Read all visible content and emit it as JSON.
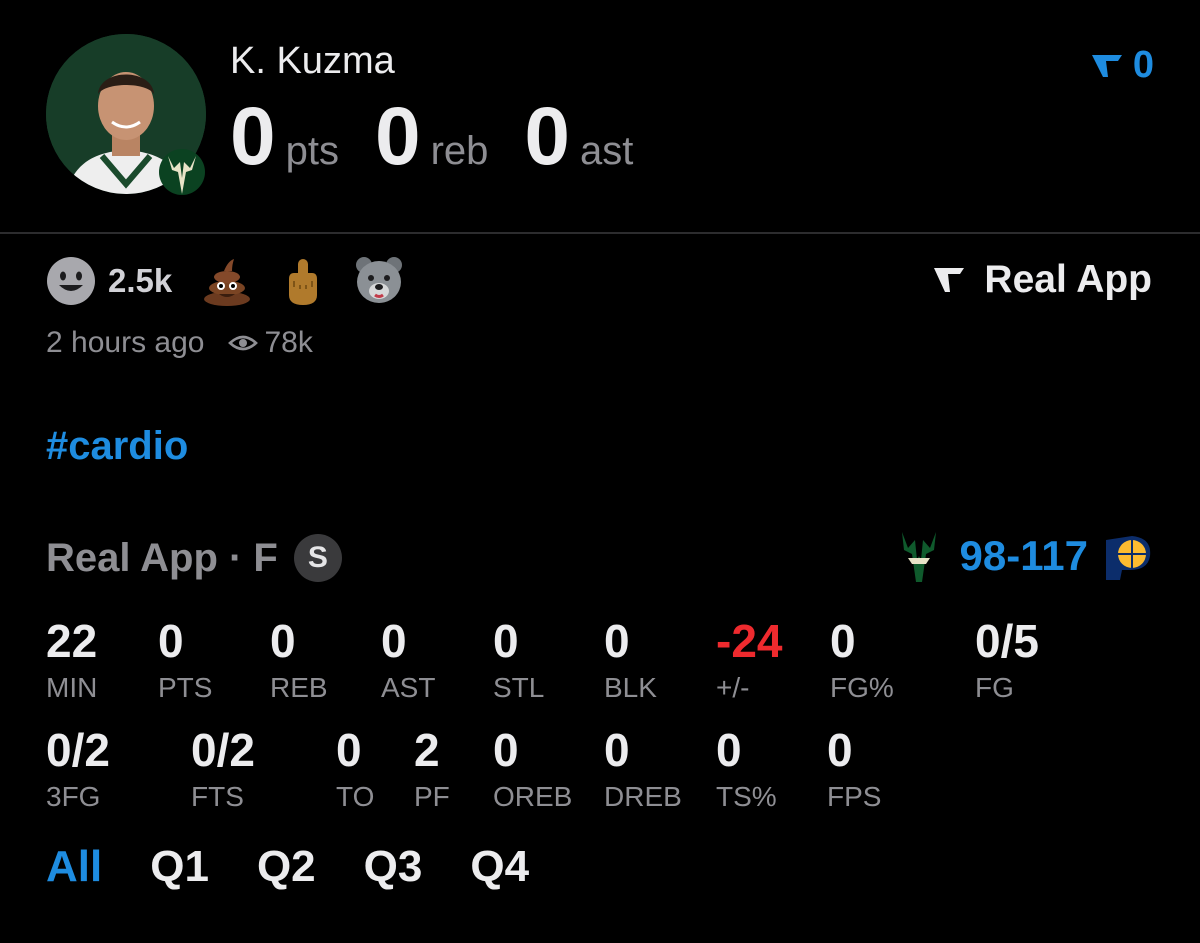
{
  "player": {
    "name": "K. Kuzma",
    "headline": [
      {
        "value": "0",
        "unit": "pts"
      },
      {
        "value": "0",
        "unit": "reb"
      },
      {
        "value": "0",
        "unit": "ast"
      }
    ]
  },
  "vote_counter": {
    "value": "0",
    "icon": "real-app-logo-icon"
  },
  "reactions": {
    "count": "2.5k",
    "icons": [
      "smiley-icon",
      "poop-emoji-icon",
      "middle-finger-emoji-icon",
      "bear-emoji-icon"
    ]
  },
  "brand_link": {
    "label": "Real App",
    "icon": "real-app-logo-icon"
  },
  "post_meta": {
    "time": "2 hours ago",
    "views": "78k",
    "views_icon": "eye-icon"
  },
  "hashtag": "#cardio",
  "game": {
    "label": "Real App · F",
    "status_chip": "S",
    "score": "98-117",
    "home_team_icon": "bucks-logo-icon",
    "away_team_icon": "pacers-logo-icon"
  },
  "stats_row1": [
    {
      "value": "22",
      "label": "MIN"
    },
    {
      "value": "0",
      "label": "PTS"
    },
    {
      "value": "0",
      "label": "REB"
    },
    {
      "value": "0",
      "label": "AST"
    },
    {
      "value": "0",
      "label": "STL"
    },
    {
      "value": "0",
      "label": "BLK"
    },
    {
      "value": "-24",
      "label": "+/-"
    },
    {
      "value": "0",
      "label": "FG%"
    },
    {
      "value": "0/5",
      "label": "FG"
    }
  ],
  "stats_row2": [
    {
      "value": "0/2",
      "label": "3FG"
    },
    {
      "value": "0/2",
      "label": "FTS"
    },
    {
      "value": "0",
      "label": "TO"
    },
    {
      "value": "2",
      "label": "PF"
    },
    {
      "value": "0",
      "label": "OREB"
    },
    {
      "value": "0",
      "label": "DREB"
    },
    {
      "value": "0",
      "label": "TS%"
    },
    {
      "value": "0",
      "label": "FPS"
    }
  ],
  "tabs": [
    {
      "label": "All",
      "active": true
    },
    {
      "label": "Q1",
      "active": false
    },
    {
      "label": "Q2",
      "active": false
    },
    {
      "label": "Q3",
      "active": false
    },
    {
      "label": "Q4",
      "active": false
    }
  ],
  "colors": {
    "accent": "#1e8ce0",
    "negative": "#ee2a2e",
    "muted": "#8e8e93",
    "background": "#000000"
  }
}
